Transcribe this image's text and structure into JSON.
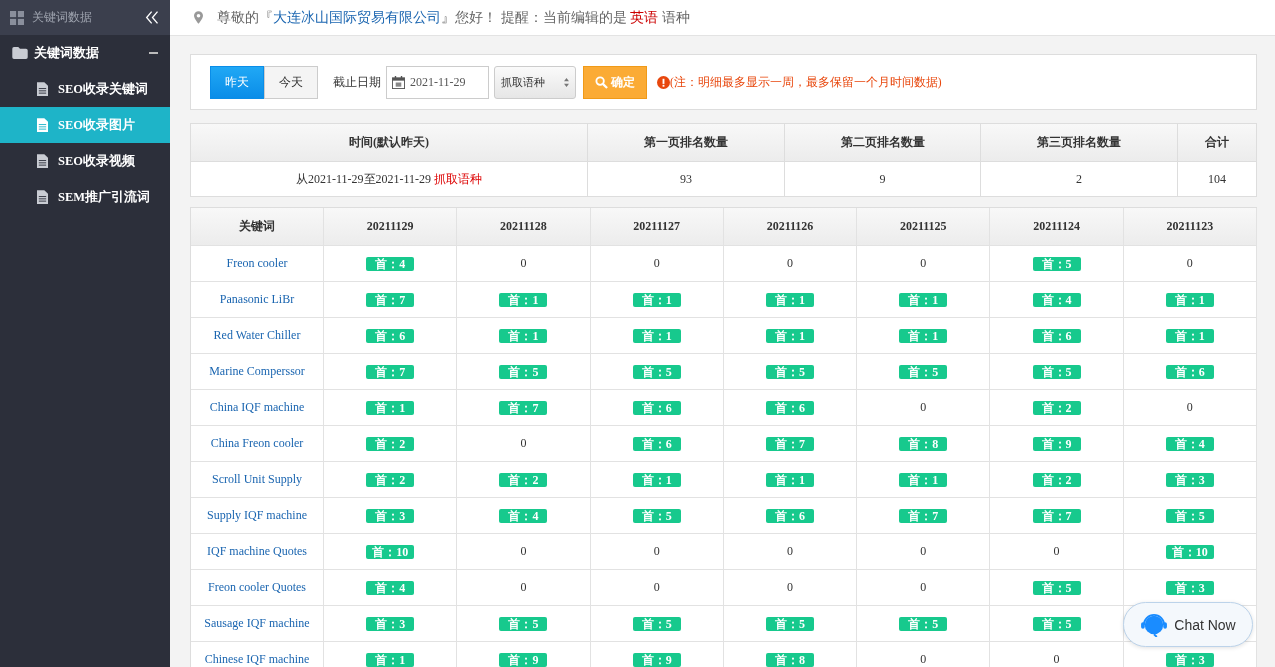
{
  "sidebar": {
    "header": "关键词数据",
    "group": {
      "label": "关键词数据",
      "expanded": true
    },
    "items": [
      {
        "label": "SEO收录关键词",
        "selected": false
      },
      {
        "label": "SEO收录图片",
        "selected": true
      },
      {
        "label": "SEO收录视频",
        "selected": false
      },
      {
        "label": "SEM推广引流词",
        "selected": false
      }
    ]
  },
  "notice": {
    "greeting": "尊敬的『",
    "company": "大连冰山国际贸易有限公司",
    "after": "』您好！ 提醒：当前编辑的是",
    "language": "英语",
    "tail": "语种"
  },
  "filter": {
    "ranges": [
      {
        "label": "昨天",
        "selected": true
      },
      {
        "label": "今天",
        "selected": false
      }
    ],
    "date_label": "截止日期",
    "date": "2021-11-29",
    "language_select": "抓取语种",
    "confirm": "确定",
    "note": "(注：明细最多显示一周，最多保留一个月时间数据)"
  },
  "summary": {
    "columns": [
      "时间(默认昨天)",
      "第一页排名数量",
      "第二页排名数量",
      "第三页排名数量",
      "合计"
    ],
    "period": "从2021-11-29至2021-11-29",
    "period_language": "抓取语种",
    "values": [
      "93",
      "9",
      "2",
      "104"
    ]
  },
  "table": {
    "columns": [
      "关键词",
      "20211129",
      "20211128",
      "20211127",
      "20211126",
      "20211125",
      "20211124",
      "20211123"
    ],
    "rows": [
      {
        "cells": [
          {
            "kind": "keyword",
            "text": "Freon cooler"
          },
          {
            "kind": "badge",
            "text": "首：4"
          },
          {
            "kind": "plain",
            "text": "0"
          },
          {
            "kind": "plain",
            "text": "0"
          },
          {
            "kind": "plain",
            "text": "0"
          },
          {
            "kind": "plain",
            "text": "0"
          },
          {
            "kind": "badge",
            "text": "首：5"
          },
          {
            "kind": "plain",
            "text": "0"
          }
        ]
      },
      {
        "cells": [
          {
            "kind": "keyword",
            "text": "Panasonic LiBr"
          },
          {
            "kind": "badge",
            "text": "首：7"
          },
          {
            "kind": "badge",
            "text": "首：1"
          },
          {
            "kind": "badge",
            "text": "首：1"
          },
          {
            "kind": "badge",
            "text": "首：1"
          },
          {
            "kind": "badge",
            "text": "首：1"
          },
          {
            "kind": "badge",
            "text": "首：4"
          },
          {
            "kind": "badge",
            "text": "首：1"
          }
        ]
      },
      {
        "cells": [
          {
            "kind": "keyword",
            "text": "Red Water Chiller"
          },
          {
            "kind": "badge",
            "text": "首：6"
          },
          {
            "kind": "badge",
            "text": "首：1"
          },
          {
            "kind": "badge",
            "text": "首：1"
          },
          {
            "kind": "badge",
            "text": "首：1"
          },
          {
            "kind": "badge",
            "text": "首：1"
          },
          {
            "kind": "badge",
            "text": "首：6"
          },
          {
            "kind": "badge",
            "text": "首：1"
          }
        ]
      },
      {
        "cells": [
          {
            "kind": "keyword",
            "text": "Marine Comperssor"
          },
          {
            "kind": "badge",
            "text": "首：7"
          },
          {
            "kind": "badge",
            "text": "首：5"
          },
          {
            "kind": "badge",
            "text": "首：5"
          },
          {
            "kind": "badge",
            "text": "首：5"
          },
          {
            "kind": "badge",
            "text": "首：5"
          },
          {
            "kind": "badge",
            "text": "首：5"
          },
          {
            "kind": "badge",
            "text": "首：6"
          }
        ]
      },
      {
        "cells": [
          {
            "kind": "keyword",
            "text": "China IQF machine"
          },
          {
            "kind": "badge",
            "text": "首：1"
          },
          {
            "kind": "badge",
            "text": "首：7"
          },
          {
            "kind": "badge",
            "text": "首：6"
          },
          {
            "kind": "badge",
            "text": "首：6"
          },
          {
            "kind": "plain",
            "text": "0"
          },
          {
            "kind": "badge",
            "text": "首：2"
          },
          {
            "kind": "plain",
            "text": "0"
          }
        ]
      },
      {
        "cells": [
          {
            "kind": "keyword",
            "text": "China Freon cooler"
          },
          {
            "kind": "badge",
            "text": "首：2"
          },
          {
            "kind": "plain",
            "text": "0"
          },
          {
            "kind": "badge",
            "text": "首：6"
          },
          {
            "kind": "badge",
            "text": "首：7"
          },
          {
            "kind": "badge",
            "text": "首：8"
          },
          {
            "kind": "badge",
            "text": "首：9"
          },
          {
            "kind": "badge",
            "text": "首：4"
          }
        ]
      },
      {
        "cells": [
          {
            "kind": "keyword",
            "text": "Scroll Unit Supply"
          },
          {
            "kind": "badge",
            "text": "首：2"
          },
          {
            "kind": "badge",
            "text": "首：2"
          },
          {
            "kind": "badge",
            "text": "首：1"
          },
          {
            "kind": "badge",
            "text": "首：1"
          },
          {
            "kind": "badge",
            "text": "首：1"
          },
          {
            "kind": "badge",
            "text": "首：2"
          },
          {
            "kind": "badge",
            "text": "首：3"
          }
        ]
      },
      {
        "cells": [
          {
            "kind": "keyword",
            "text": "Supply IQF machine"
          },
          {
            "kind": "badge",
            "text": "首：3"
          },
          {
            "kind": "badge",
            "text": "首：4"
          },
          {
            "kind": "badge",
            "text": "首：5"
          },
          {
            "kind": "badge",
            "text": "首：6"
          },
          {
            "kind": "badge",
            "text": "首：7"
          },
          {
            "kind": "badge",
            "text": "首：7"
          },
          {
            "kind": "badge",
            "text": "首：5"
          }
        ]
      },
      {
        "cells": [
          {
            "kind": "keyword",
            "text": "IQF machine Quotes"
          },
          {
            "kind": "badge",
            "text": "首：10"
          },
          {
            "kind": "plain",
            "text": "0"
          },
          {
            "kind": "plain",
            "text": "0"
          },
          {
            "kind": "plain",
            "text": "0"
          },
          {
            "kind": "plain",
            "text": "0"
          },
          {
            "kind": "plain",
            "text": "0"
          },
          {
            "kind": "badge",
            "text": "首：10"
          }
        ]
      },
      {
        "cells": [
          {
            "kind": "keyword",
            "text": "Freon cooler Quotes"
          },
          {
            "kind": "badge",
            "text": "首：4"
          },
          {
            "kind": "plain",
            "text": "0"
          },
          {
            "kind": "plain",
            "text": "0"
          },
          {
            "kind": "plain",
            "text": "0"
          },
          {
            "kind": "plain",
            "text": "0"
          },
          {
            "kind": "badge",
            "text": "首：5"
          },
          {
            "kind": "badge",
            "text": "首：3"
          }
        ]
      },
      {
        "cells": [
          {
            "kind": "keyword",
            "text": "Sausage IQF machine"
          },
          {
            "kind": "badge",
            "text": "首：3"
          },
          {
            "kind": "badge",
            "text": "首：5"
          },
          {
            "kind": "badge",
            "text": "首：5"
          },
          {
            "kind": "badge",
            "text": "首：5"
          },
          {
            "kind": "badge",
            "text": "首：5"
          },
          {
            "kind": "badge",
            "text": "首：5"
          }
        ]
      },
      {
        "cells": [
          {
            "kind": "keyword",
            "text": "Chinese IQF machine"
          },
          {
            "kind": "badge",
            "text": "首：1"
          },
          {
            "kind": "badge",
            "text": "首：9"
          },
          {
            "kind": "badge",
            "text": "首：9"
          },
          {
            "kind": "badge",
            "text": "首：8"
          },
          {
            "kind": "plain",
            "text": "0"
          },
          {
            "kind": "plain",
            "text": "0"
          },
          {
            "kind": "badge",
            "text": "首：3"
          }
        ]
      }
    ]
  },
  "chat": {
    "label": "Chat Now"
  }
}
